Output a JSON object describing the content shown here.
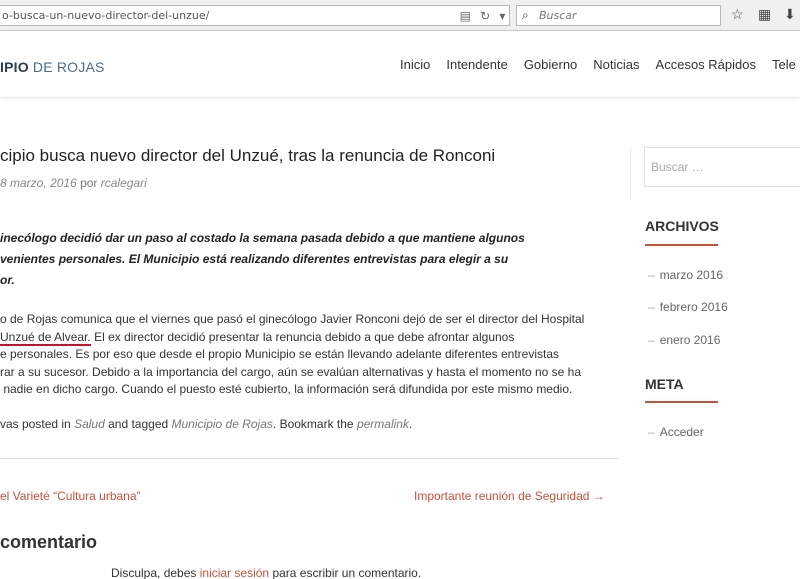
{
  "browser": {
    "url": "o-busca-un-nuevo-director-del-unzue/",
    "search_placeholder": "Buscar"
  },
  "site": {
    "logo_bold": "IPIO",
    "logo_rest": "DE ROJAS",
    "nav": [
      "Inicio",
      "Intendente",
      "Gobierno",
      "Noticias",
      "Accesos Rápidos",
      "Tele"
    ]
  },
  "post": {
    "title": "cipio busca nuevo director del Unzué, tras la renuncia de Ronconi",
    "date": "8 marzo, 2016",
    "by": "por",
    "author": "rcalegari",
    "lead_lines": [
      "inecólogo decidió dar un paso al costado la semana pasada debido a que mantiene algunos",
      "venientes personales. El Municipio está realizando diferentes entrevistas para elegir a su",
      "or."
    ],
    "body_line1": "o de Rojas comunica que el viernes que pasó el ginecólogo Javier Ronconi dejó de ser el director del Hospital",
    "body_highlight": "Unzué de Alvear.",
    "body_line2_rest": " El ex director decidió presentar la renuncia debido a que debe afrontar algunos",
    "body_line3": "e personales. Es por eso que desde el propio Municipio se están llevando adelante diferentes entrevistas",
    "body_line4": "rar a su sucesor. Debido a la importancia del cargo, aún se evalúan alternativas y hasta el momento no se ha",
    "body_line5": " nadie en dicho cargo. Cuando el puesto esté cubierto, la información será difundida por este mismo medio.",
    "tags_prefix": "vas posted in",
    "category": "Salud",
    "tagged_word": "and tagged",
    "tag": "Municipio de Rojas",
    "bookmark": ". Bookmark the",
    "permalink": "permalink",
    "period": "."
  },
  "nav_links": {
    "prev": "el Varieté “Cultura urbana”",
    "next": "Importante reunión de Seguridad →"
  },
  "comments": {
    "title": "comentario",
    "note_prefix": "Disculpa, debes",
    "login_link": "iniciar sesión",
    "note_suffix": "para escribir un comentario."
  },
  "sidebar": {
    "search_placeholder": "Buscar …",
    "archives_title": "ARCHIVOS",
    "archives": [
      "marzo 2016",
      "febrero 2016",
      "enero 2016"
    ],
    "meta_title": "META",
    "meta_items": [
      "Acceder"
    ]
  },
  "colors": {
    "accent": "#c9503a",
    "highlight_underline": "#c8102e"
  }
}
